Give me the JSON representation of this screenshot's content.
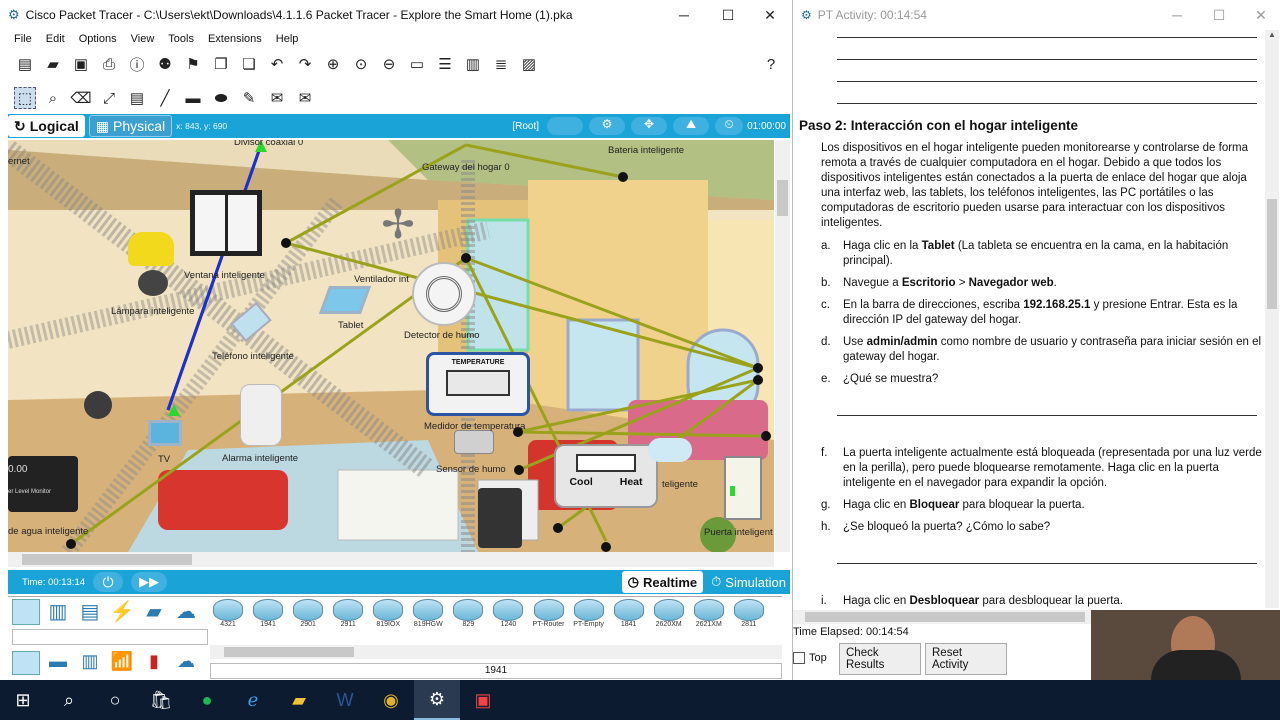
{
  "pt_window": {
    "title": "Cisco Packet Tracer - C:\\Users\\ekt\\Downloads\\4.1.1.6 Packet Tracer - Explore the Smart Home (1).pka",
    "menu": [
      "File",
      "Edit",
      "Options",
      "View",
      "Tools",
      "Extensions",
      "Help"
    ],
    "mode_logical": "Logical",
    "mode_physical": "Physical",
    "coords": "x: 843, y: 690",
    "root": "[Root]",
    "clock": "01:00:00",
    "devices": {
      "divisor": "Divisor coaxial 0",
      "internet": "ernet",
      "gateway": "Gateway del hogar 0",
      "bateria": "Bateria inteligente",
      "ventana": "Ventana inteligente",
      "ventilador": "Ventilador int",
      "lampara": "Lámpara inteligente",
      "tablet": "Tablet",
      "detector": "Detector de humo",
      "telefono": "Teléfono inteligente",
      "medidor": "Medidor de temperatura",
      "sensor": "Sensor de humo",
      "tv": "TV",
      "alarma": "Alarma inteligente",
      "agua": "de agua inteligente",
      "level_monitor": "er Level Monitor",
      "level_value": "0.00",
      "teligente": "teligente",
      "puerta": "Puerta inteligent",
      "temperature_title": "TEMPERATURE",
      "cool": "Cool",
      "heat": "Heat"
    },
    "sim_time": "Time: 00:13:14",
    "realtime": "Realtime",
    "simulation": "Simulation",
    "device_models": [
      "4321",
      "1941",
      "2901",
      "2911",
      "819IOX",
      "819HGW",
      "829",
      "1240",
      "PT-Router",
      "PT-Empty",
      "1841",
      "2620XM",
      "2621XM",
      "2811"
    ],
    "selected_model": "1941"
  },
  "activity_window": {
    "title": "PT Activity: 00:14:54",
    "step_title": "Paso 2: Interacción con el hogar inteligente",
    "intro": "Los dispositivos en el hogar inteligente pueden monitorearse y controlarse de forma remota a través de cualquier computadora en el hogar. Debido a que todos los dispositivos inteligentes están conectados a la puerta de enlace del hogar que aloja una interfaz web, las tablets, los teléfonos inteligentes, las PC portátiles o las computadoras de escritorio pueden usarse para interactuar con los dispositivos inteligentes.",
    "items": [
      {
        "k": "a.",
        "pre": "Haga clic en la ",
        "b1": "Tablet",
        "post": " (La tableta se encuentra en la cama, en la habitación principal)."
      },
      {
        "k": "b.",
        "pre": "Navegue a ",
        "b1": "Escritorio",
        "mid": " > ",
        "b2": "Navegador web",
        "post": "."
      },
      {
        "k": "c.",
        "pre": "En la barra de direcciones, escriba ",
        "b1": "192.168.25.1",
        "post": " y presione Entrar. Esta es la dirección IP del gateway del hogar."
      },
      {
        "k": "d.",
        "pre": "Use ",
        "b1": "admin/admin",
        "post": " como nombre de usuario y contraseña para iniciar sesión en el gateway del hogar."
      },
      {
        "k": "e.",
        "pre": "¿Qué se muestra?"
      }
    ],
    "items2": [
      {
        "k": "f.",
        "pre": "La puerta inteligente actualmente está bloqueada (representada por una luz verde en la perilla), pero puede bloquearse remotamente. Haga clic en la puerta inteligente en el navegador para expandir la opción."
      },
      {
        "k": "g.",
        "pre": "Haga clic en ",
        "b1": "Bloquear",
        "post": " para bloquear la puerta."
      },
      {
        "k": "h.",
        "pre": "¿Se bloqueó la puerta? ¿Cómo lo sabe?"
      }
    ],
    "item_i": {
      "k": "i.",
      "pre": "Haga clic en ",
      "b1": "Desbloquear",
      "post": " para desbloquear la puerta."
    },
    "time_elapsed": "Time Elapsed: 00:14:54",
    "top_label": "Top",
    "check_results": "Check Results",
    "reset_activity": "Reset Activity"
  }
}
